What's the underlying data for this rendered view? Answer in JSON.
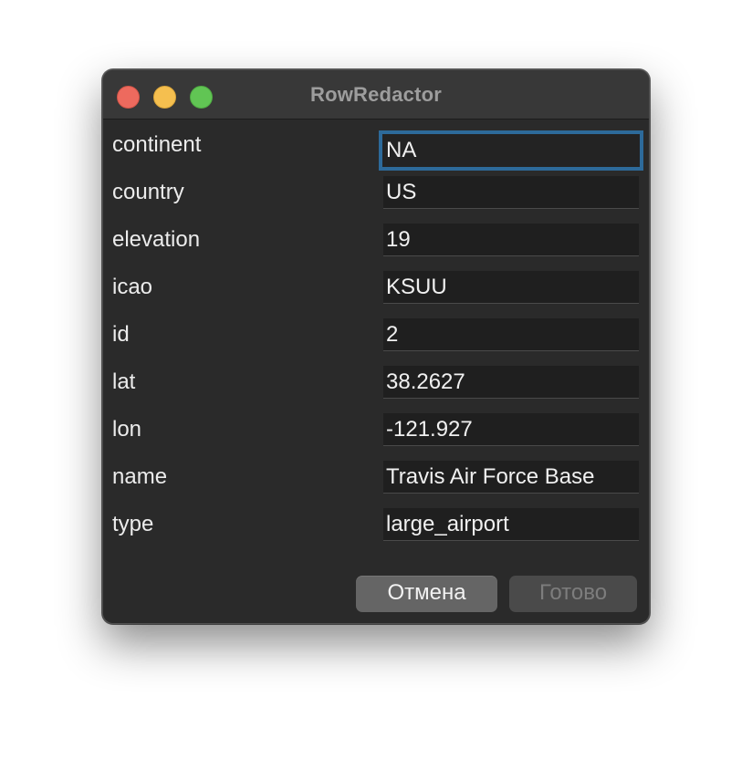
{
  "window": {
    "title": "RowRedactor"
  },
  "fields": [
    {
      "label": "continent",
      "value": "NA",
      "focused": true
    },
    {
      "label": "country",
      "value": "US"
    },
    {
      "label": "elevation",
      "value": "19"
    },
    {
      "label": "icao",
      "value": "KSUU"
    },
    {
      "label": "id",
      "value": "2"
    },
    {
      "label": "lat",
      "value": "38.2627"
    },
    {
      "label": "lon",
      "value": "-121.927"
    },
    {
      "label": "name",
      "value": "Travis Air Force Base"
    },
    {
      "label": "type",
      "value": "large_airport"
    }
  ],
  "buttons": {
    "cancel_label": "Отмена",
    "done_label": "Готово"
  },
  "colors": {
    "focus_ring": "#2d6a9a",
    "close": "#ed6a5e",
    "minimize": "#f5bf4f",
    "maximize": "#61c554"
  }
}
